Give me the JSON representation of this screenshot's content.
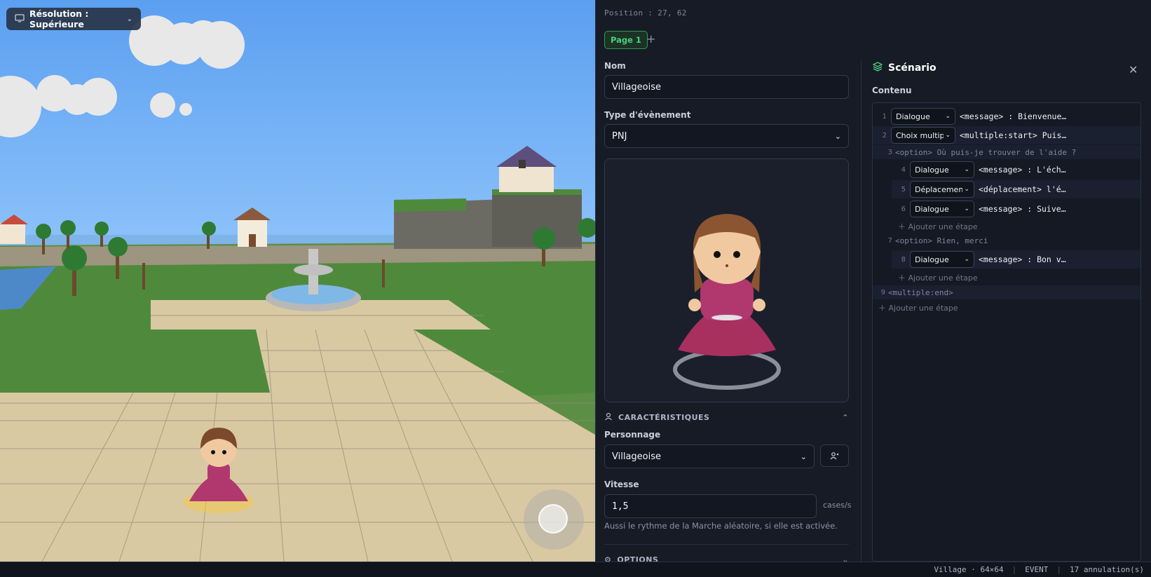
{
  "viewport": {
    "resolution_label": "Résolution : Supérieure"
  },
  "panel": {
    "position_readout": "Position : 27, 62",
    "page_tab": "Page 1",
    "add_page": "+",
    "name_label": "Nom",
    "name_value": "Villageoise",
    "event_type_label": "Type d'évènement",
    "event_type_value": "PNJ",
    "characteristics_heading": "CARACTÉRISTIQUES",
    "character_label": "Personnage",
    "character_value": "Villageoise",
    "speed_label": "Vitesse",
    "speed_value": "1,5",
    "speed_unit": "cases/s",
    "speed_hint": "Aussi le rythme de la Marche aléatoire, si elle est activée.",
    "options_heading": "OPTIONS"
  },
  "scenario": {
    "title": "Scénario",
    "content_label": "Contenu",
    "steps": [
      {
        "num": "1",
        "type": "Dialogue",
        "text": "<message> : Bienvenue…"
      },
      {
        "num": "2",
        "type": "Choix multiple",
        "text": "<multiple:start> Puis…"
      },
      {
        "num": "3",
        "option": "<option> Où puis-je trouver de l'aide ?"
      },
      {
        "num": "4",
        "type": "Dialogue",
        "text": "<message> : L'éch…"
      },
      {
        "num": "5",
        "type": "Déplacement",
        "text": "<déplacement> l'é…"
      },
      {
        "num": "6",
        "type": "Dialogue",
        "text": "<message> : Suive…"
      },
      {
        "num": "7",
        "option": "<option> Rien, merci"
      },
      {
        "num": "8",
        "type": "Dialogue",
        "text": "<message> : Bon v…"
      },
      {
        "num": "9",
        "option": "<multiple:end>"
      }
    ],
    "add_step": "Ajouter une étape"
  },
  "status": {
    "map": "Village · 64×64",
    "mode": "EVENT",
    "undo": "17 annulation(s)"
  },
  "icons": [
    "monitor-icon",
    "chevron-down-icon",
    "layers-icon",
    "close-icon",
    "user-icon",
    "chevron-up-icon",
    "users-icon",
    "gear-icon",
    "plus-icon"
  ]
}
